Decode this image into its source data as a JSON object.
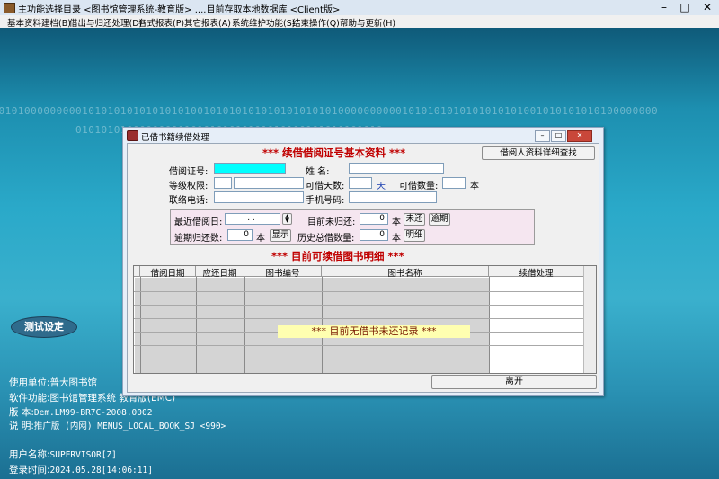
{
  "window": {
    "title": "主功能选择目录 <图书馆管理系统-教育版> ....目前存取本地数据库 <Client版>",
    "min": "–",
    "max": "□",
    "close": "✕"
  },
  "menu": [
    "基本资料建档(B)",
    "借出与归还处理(D)",
    "各式报表(P)",
    "其它报表(A)",
    "系统维护功能(S)",
    "结束操作(Q)",
    "帮助与更新(H)"
  ],
  "background": {
    "binary_row1": "01010101000000000101010101010101010010101010101010101010100000000001010101010101010101001010101010100000000",
    "binary_row2": "010101010000000001010101010101010100101010101010"
  },
  "test_button": "测试设定",
  "info": {
    "unit_label": "使用单位:",
    "unit_value": "普大图书馆",
    "func_label": "软件功能:",
    "func_value": "图书馆管理系统 教育版(EMC)",
    "ver_label": "版      本:",
    "ver_value": "Dem.LM99-BR7C-2008.0002",
    "desc_label": "说      明:",
    "desc_value": "推广版 (内网) MENUS_LOCAL_BOOK_SJ <990>",
    "user_label": "用户名称:",
    "user_value": "SUPERVISOR[Z]",
    "login_label": "登录时间:",
    "login_value": "2024.05.28[14:06:11]"
  },
  "dialog": {
    "title": "已借书籍续借处理",
    "section1": "***  续借借阅证号基本资料  ***",
    "detail_button": "借阅人资料详细查找",
    "card_label": "借阅证号:",
    "name_label": "姓      名:",
    "level_label": "等级权限:",
    "days_label": "可借天数:",
    "days_unit": "天",
    "qty_label": "可借数量:",
    "qty_unit": "本",
    "phone_label": "联络电话:",
    "mobile_label": "手机号码:",
    "last_borrow_label": "最近借阅日:",
    "last_borrow_value": ".  .",
    "unreturned_label": "目前未归还:",
    "unreturned_value": "0",
    "unreturned_unit": "本",
    "unreturned_btn": "未还",
    "overdue_btn": "逾期",
    "overdue_label": "逾期归还数:",
    "overdue_value": "0",
    "overdue_unit": "本",
    "show_btn": "显示",
    "history_label": "历史总借数量:",
    "history_value": "0",
    "history_unit": "本",
    "detail_btn": "明细",
    "section2": "***  目前可续借图书明细  ***",
    "columns": [
      "借阅日期",
      "应还日期",
      "图书编号",
      "图书名称",
      "续借处理"
    ],
    "no_record": "***  目前无借书未还记录  ***",
    "leave_button": "离开"
  }
}
